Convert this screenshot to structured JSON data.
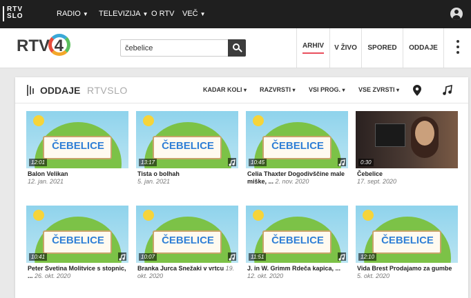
{
  "topbar": {
    "logo_line1": "RTV",
    "logo_line2": "SLO",
    "nav": [
      {
        "label": "RADIO",
        "caret": true
      },
      {
        "label": "TELEVIZIJA",
        "caret": true
      },
      {
        "label": "O RTV",
        "caret": false
      },
      {
        "label": "VEČ",
        "caret": true
      }
    ]
  },
  "header": {
    "brand": "RTV",
    "brand_num": "4",
    "search_value": "čebelice",
    "nav": [
      "ARHIV",
      "V ŽIVO",
      "SPORED",
      "ODDAJE"
    ],
    "active_nav": "ARHIV",
    "accent_color": "#e94d5c"
  },
  "panel": {
    "title": "ODDAJE",
    "subtitle": "RTVSLO",
    "filters": [
      "KADAR KOLI",
      "RAZVRSTI",
      "VSI PROG.",
      "VSE ZVRSTI"
    ]
  },
  "cards": [
    {
      "duration": "12:01",
      "title": "Balon Velikan",
      "date": "12. jan. 2021",
      "kind": "cartoon",
      "badge": false
    },
    {
      "duration": "13:17",
      "title": "Tista o bolhah",
      "date": "5. jan. 2021",
      "kind": "cartoon",
      "badge": true
    },
    {
      "duration": "10:45",
      "title": "Celia Thaxter Dogodivščine male miške, ...",
      "date": "2. nov. 2020",
      "kind": "cartoon",
      "badge": true
    },
    {
      "duration": "0:30",
      "title": "Čebelice",
      "date": "17. sept. 2020",
      "kind": "video",
      "badge": false
    },
    {
      "duration": "10:41",
      "title": "Peter Svetina Molitvice s stopnic, ...",
      "date": "26. okt. 2020",
      "kind": "cartoon",
      "badge": true
    },
    {
      "duration": "10:07",
      "title": "Branka Jurca Snežaki v vrtcu",
      "date": "19. okt. 2020",
      "kind": "cartoon",
      "badge": true
    },
    {
      "duration": "11:51",
      "title": "J. in W. Grimm Rdeča kapica, ...",
      "date": "12. okt. 2020",
      "kind": "cartoon",
      "badge": true
    },
    {
      "duration": "12:10",
      "title": "Vida Brest Prodajamo za gumbe",
      "date": "5. okt. 2020",
      "kind": "cartoon",
      "badge": false
    }
  ],
  "thumb_text": "ČEBELICE"
}
